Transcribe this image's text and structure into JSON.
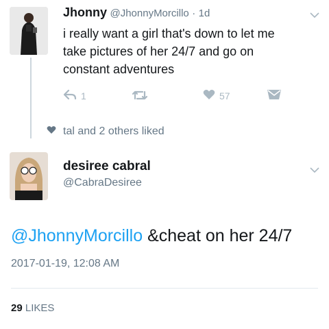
{
  "tweet1": {
    "name": "Jhonny",
    "handle": "@JhonnyMorcillo",
    "separator": "·",
    "time": "1d",
    "text_line1": "i really want a girl that's down to let me",
    "text_line2": "take pictures of her 24/7 and go on",
    "text_line3": "constant adventures",
    "reply_count": "1",
    "like_count": "57",
    "icons": [
      "reply-icon",
      "retweet-icon",
      "heart-icon",
      "message-icon",
      "chevron-down-icon"
    ]
  },
  "social": {
    "liked_text": "tal and 2 others liked"
  },
  "tweet2": {
    "name": "desiree cabral",
    "handle": "@CabraDesiree",
    "mention": "@JhonnyMorcillo",
    "text": " &cheat on her 24/7",
    "timestamp": "2017-01-19, 12:08 AM",
    "likes_count": "29",
    "likes_label": "LIKES"
  },
  "colors": {
    "link": "#1da1f2",
    "secondary": "#657786",
    "icon": "#aab8c2",
    "divider": "#e1e8ed"
  }
}
